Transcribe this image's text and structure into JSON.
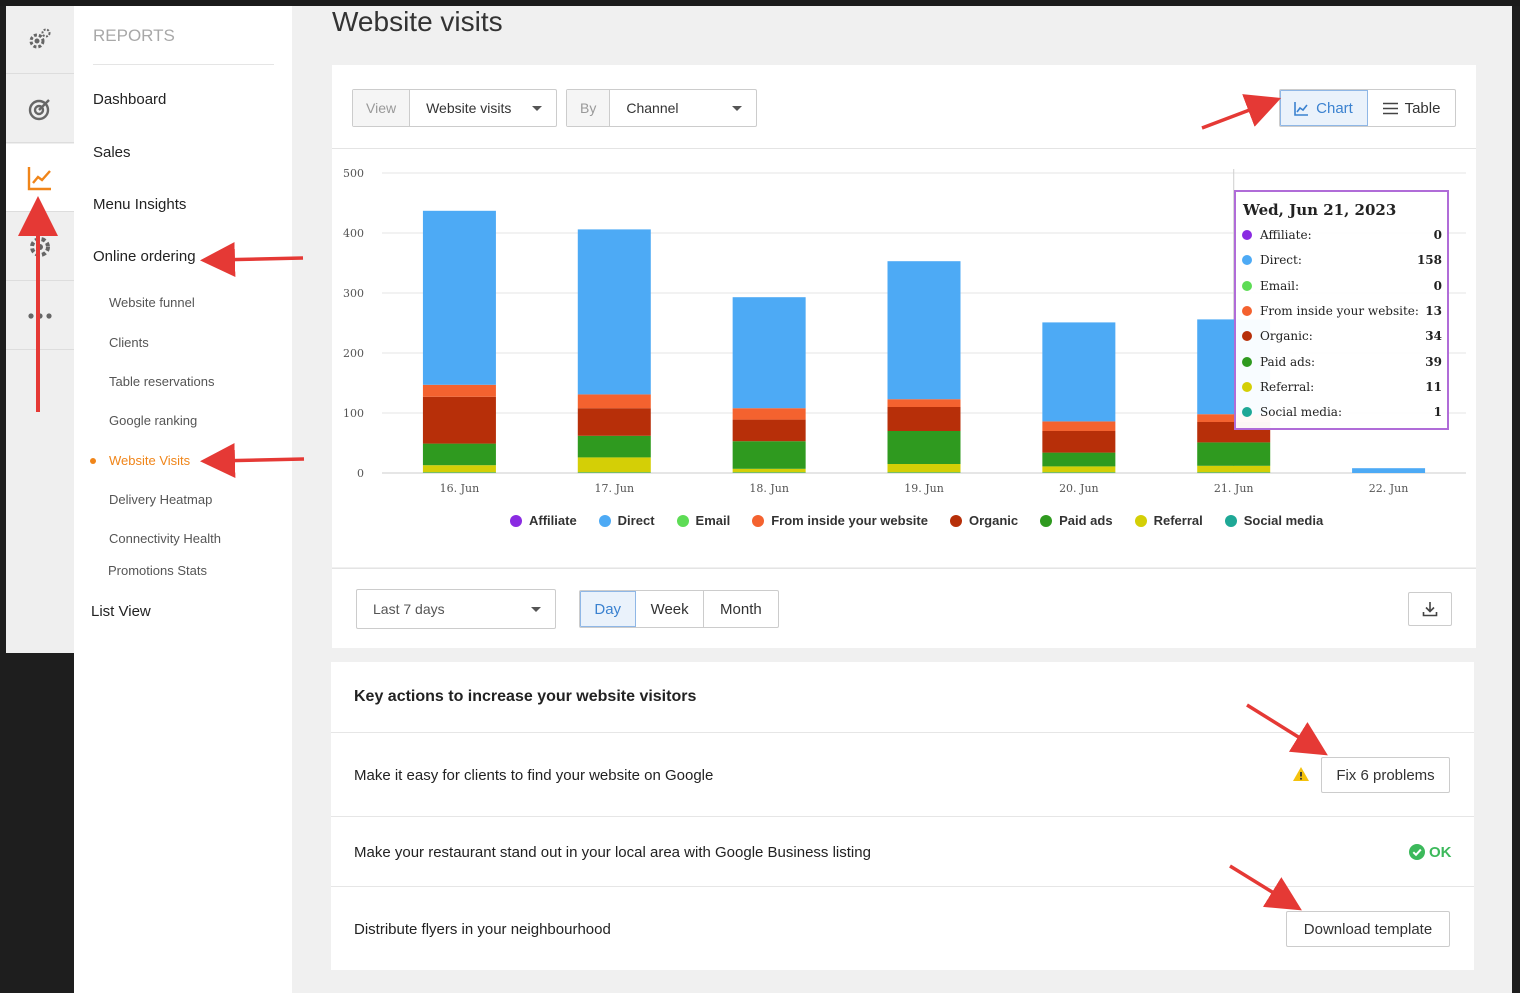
{
  "sidebar": {
    "title": "REPORTS",
    "items": [
      {
        "label": "Dashboard"
      },
      {
        "label": "Sales"
      },
      {
        "label": "Menu Insights"
      },
      {
        "label": "Online ordering"
      }
    ],
    "subitems": [
      {
        "label": "Website funnel"
      },
      {
        "label": "Clients"
      },
      {
        "label": "Table reservations"
      },
      {
        "label": "Google ranking"
      },
      {
        "label": "Website Visits",
        "active": true
      },
      {
        "label": "Delivery Heatmap"
      },
      {
        "label": "Connectivity Health"
      },
      {
        "label": "Promotions Stats"
      }
    ],
    "list_view": "List View"
  },
  "rail_icons": [
    "settings-gears-icon",
    "target-icon",
    "chart-icon",
    "gear-icon",
    "more-dots-icon"
  ],
  "page": {
    "title": "Website visits"
  },
  "filters": {
    "view_label": "View",
    "view_value": "Website visits",
    "by_label": "By",
    "by_value": "Channel"
  },
  "view_toggle": {
    "chart": "Chart",
    "table": "Table",
    "active": "Chart"
  },
  "period": {
    "range": "Last 7 days",
    "granularity": [
      "Day",
      "Week",
      "Month"
    ],
    "active": "Day"
  },
  "chart_data": {
    "type": "bar",
    "stacked": true,
    "categories": [
      "16. Jun",
      "17. Jun",
      "18. Jun",
      "19. Jun",
      "20. Jun",
      "21. Jun",
      "22. Jun"
    ],
    "ylim": [
      0,
      500
    ],
    "yticks": [
      0,
      100,
      200,
      300,
      400,
      500
    ],
    "grid": true,
    "legend_position": "bottom",
    "series": [
      {
        "name": "Affiliate",
        "color": "#8a2be2",
        "values": [
          0,
          0,
          0,
          0,
          0,
          0,
          0
        ]
      },
      {
        "name": "Direct",
        "color": "#4daaf5",
        "values": [
          290,
          275,
          185,
          230,
          165,
          158,
          8
        ]
      },
      {
        "name": "Email",
        "color": "#5ddc55",
        "values": [
          0,
          0,
          0,
          0,
          0,
          0,
          0
        ]
      },
      {
        "name": "From inside your website",
        "color": "#f4622f",
        "values": [
          20,
          23,
          19,
          13,
          16,
          13,
          0
        ]
      },
      {
        "name": "Organic",
        "color": "#b72f09",
        "values": [
          78,
          46,
          36,
          40,
          36,
          34,
          0
        ]
      },
      {
        "name": "Paid ads",
        "color": "#2f9a1f",
        "values": [
          36,
          36,
          46,
          55,
          23,
          39,
          0
        ]
      },
      {
        "name": "Referral",
        "color": "#d4cf06",
        "values": [
          12,
          25,
          6,
          14,
          10,
          11,
          0
        ]
      },
      {
        "name": "Social media",
        "color": "#1ea896",
        "values": [
          1,
          1,
          1,
          1,
          1,
          1,
          0
        ]
      }
    ],
    "tooltip": {
      "title": "Wed, Jun 21, 2023",
      "rows": [
        {
          "name": "Affiliate:",
          "value": "0",
          "color": "#8a2be2"
        },
        {
          "name": "Direct:",
          "value": "158",
          "color": "#4daaf5"
        },
        {
          "name": "Email:",
          "value": "0",
          "color": "#5ddc55"
        },
        {
          "name": "From inside your website:",
          "value": "13",
          "color": "#f4622f"
        },
        {
          "name": "Organic:",
          "value": "34",
          "color": "#b72f09"
        },
        {
          "name": "Paid ads:",
          "value": "39",
          "color": "#2f9a1f"
        },
        {
          "name": "Referral:",
          "value": "11",
          "color": "#d4cf06"
        },
        {
          "name": "Social media:",
          "value": "1",
          "color": "#1ea896"
        }
      ]
    }
  },
  "actions": {
    "title": "Key actions to increase your website visitors",
    "rows": [
      {
        "text": "Make it easy for clients to find your website on Google",
        "button": "Fix 6 problems",
        "status": "warning"
      },
      {
        "text": "Make your restaurant stand out in your local area with Google Business listing",
        "status_text": "OK"
      },
      {
        "text": "Distribute flyers in your neighbourhood",
        "button": "Download template"
      }
    ]
  },
  "colors": {
    "accent": "#f08519",
    "active_blue": "#3b82d0",
    "annotation_red": "#e53935",
    "ok_green": "#3cb95b",
    "warn_yellow": "#f4c20d"
  }
}
